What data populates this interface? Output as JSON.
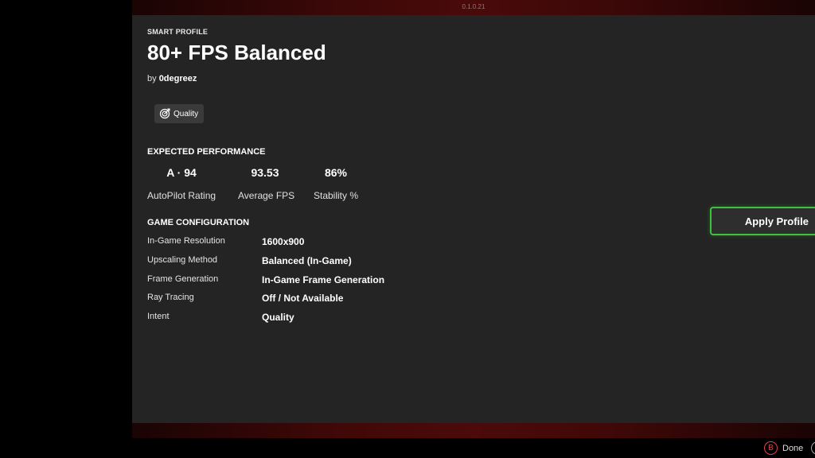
{
  "app": {
    "version": "0.1.0.21"
  },
  "profile": {
    "kind_label": "SMART PROFILE",
    "title": "80+ FPS Balanced",
    "author_prefix": "by",
    "author": "0degreez",
    "tag": {
      "label": "Quality",
      "icon": "target-icon"
    }
  },
  "performance": {
    "heading": "EXPECTED PERFORMANCE",
    "stats": [
      {
        "value": "A · 94",
        "label": "AutoPilot Rating"
      },
      {
        "value": "93.53",
        "label": "Average FPS"
      },
      {
        "value": "86%",
        "label": "Stability %"
      }
    ]
  },
  "config": {
    "heading": "GAME CONFIGURATION",
    "rows": [
      {
        "key": "In-Game Resolution",
        "value": "1600x900"
      },
      {
        "key": "Upscaling Method",
        "value": "Balanced (In-Game)"
      },
      {
        "key": "Frame Generation",
        "value": "In-Game Frame Generation"
      },
      {
        "key": "Ray Tracing",
        "value": "Off / Not Available"
      },
      {
        "key": "Intent",
        "value": "Quality"
      }
    ]
  },
  "actions": {
    "apply_label": "Apply Profile"
  },
  "footer": {
    "b_glyph": "B",
    "done_label": "Done"
  },
  "colors": {
    "accent_green": "#3cc23c",
    "accent_red": "#d9434b",
    "panel": "#242424",
    "band_red": "#4a0a0a"
  }
}
